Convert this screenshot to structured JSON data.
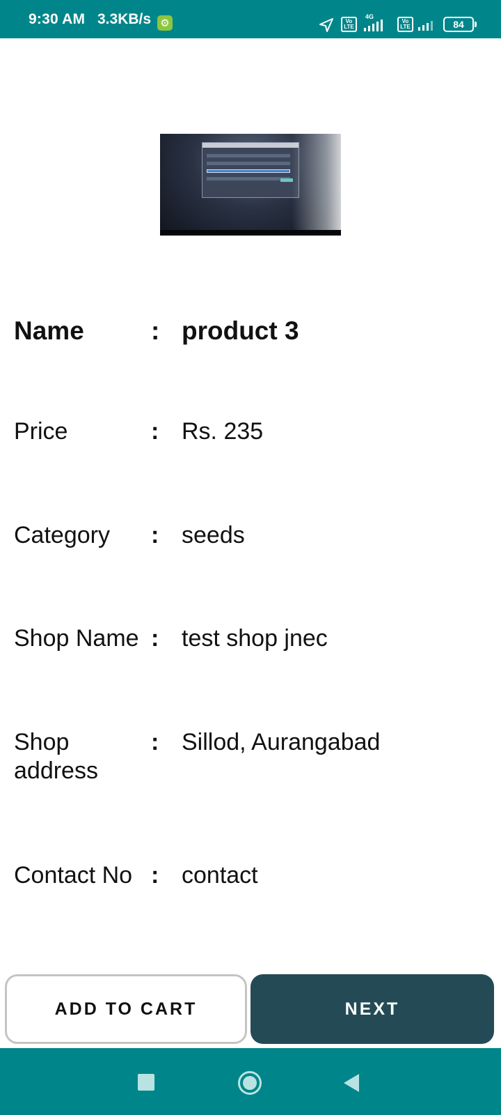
{
  "status_bar": {
    "time": "9:30 AM",
    "speed": "3.3KB/s",
    "network_label": "4G",
    "volte_label_top": "Vo",
    "volte_label_bottom": "LTE",
    "battery": "84",
    "icons": [
      "gear-icon",
      "location-arrow-icon",
      "volte-icon",
      "signal-icon",
      "battery-icon"
    ]
  },
  "product": {
    "image_icon": "product-photo",
    "details": [
      {
        "label": "Name",
        "value": "product 3"
      },
      {
        "label": "Price",
        "value": "Rs. 235"
      },
      {
        "label": "Category",
        "value": "seeds"
      },
      {
        "label": "Shop Name",
        "value": "test shop jnec"
      },
      {
        "label": "Shop address",
        "value": "Sillod, Aurangabad"
      },
      {
        "label": "Contact No",
        "value": "contact"
      }
    ],
    "separator": ":"
  },
  "actions": {
    "add_to_cart_label": "ADD TO CART",
    "next_label": "NEXT"
  },
  "nav_bar": {
    "icons": [
      "recents-icon",
      "home-icon",
      "back-icon"
    ]
  },
  "colors": {
    "status_bar": "#00868a",
    "next_button": "#244b55",
    "nav_bar": "#00868a"
  }
}
